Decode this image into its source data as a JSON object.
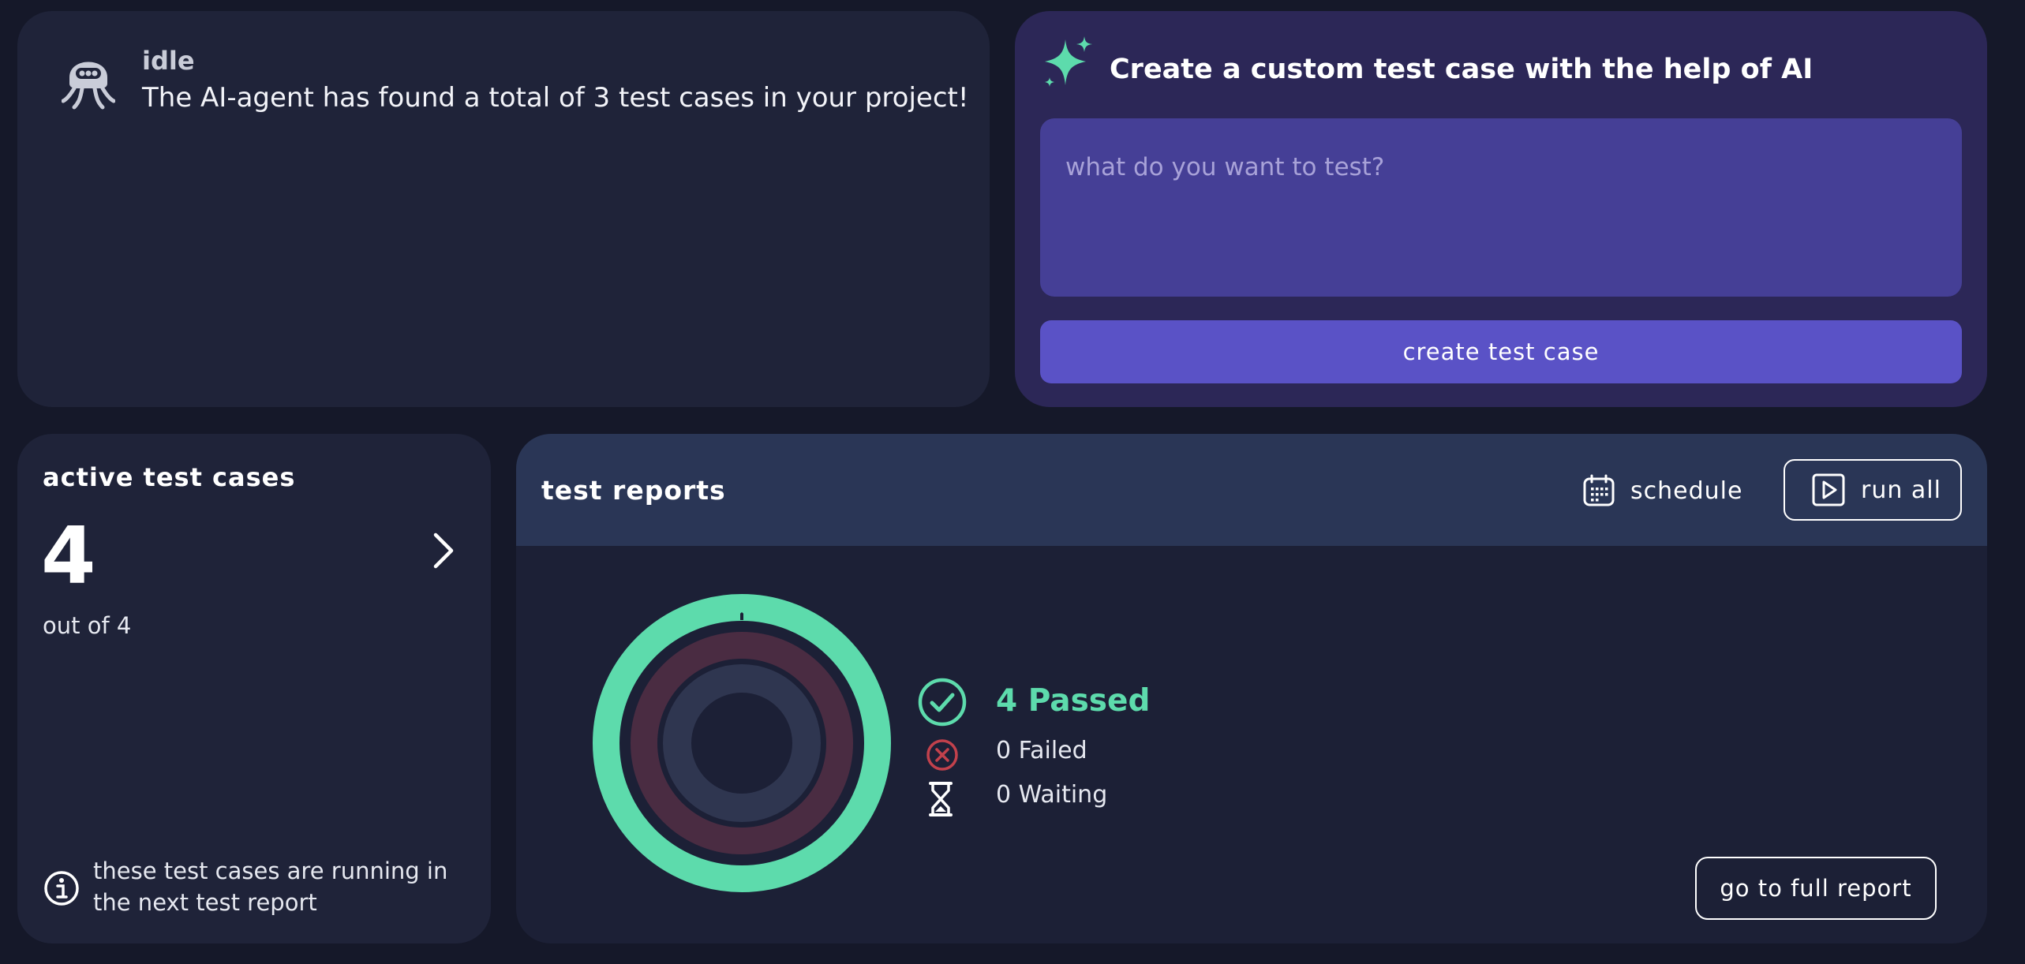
{
  "agent": {
    "icon": "robot-octopus-icon",
    "status": "idle",
    "message": "The AI-agent has found a total of 3 test cases in your project!"
  },
  "ai_create": {
    "icon": "sparkle-icon",
    "title": "Create a custom test case with the help of AI",
    "input_value": "",
    "input_placeholder": "what do you want to test?",
    "button_label": "create test case"
  },
  "active_cases": {
    "title": "active test cases",
    "count": "4",
    "total_text": "out of 4",
    "note": "these test cases are running in the next test report",
    "icons": [
      "chevron-right-icon",
      "info-icon"
    ]
  },
  "reports": {
    "title": "test reports",
    "schedule_label": "schedule",
    "run_all_label": "run all",
    "full_report_label": "go to full report",
    "icons": [
      "calendar-icon",
      "play-icon",
      "check-circle-icon",
      "x-circle-icon",
      "hourglass-icon"
    ],
    "results": {
      "passed": 4,
      "failed": 0,
      "waiting": 0,
      "passed_label": "4 Passed",
      "failed_label": "0 Failed",
      "waiting_label": "0 Waiting"
    }
  },
  "colors": {
    "background": "#151829",
    "card": "#1f2339",
    "ai_card": "#2c2757",
    "ai_input": "#453f96",
    "ai_button": "#5a52c6",
    "reports_header": "#2a3656",
    "passed": "#5ddbac",
    "failed": "#c2414c",
    "waiting": "#2f3650"
  }
}
